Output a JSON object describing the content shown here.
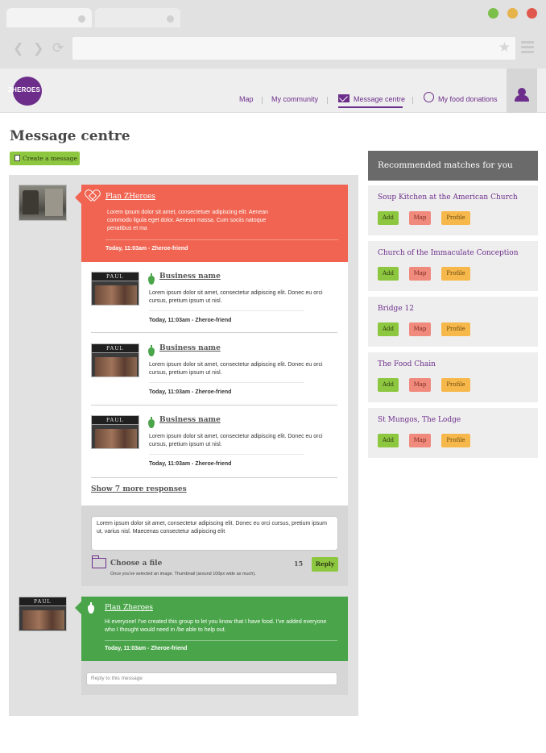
{
  "header": {
    "logo_text": "ZHEROES",
    "nav": {
      "map": "Map",
      "community": "My community",
      "messages": "Message centre",
      "donations": "My food donations"
    }
  },
  "page": {
    "title": "Message centre",
    "create_button": "Create a message"
  },
  "thread": {
    "main_post": {
      "author": "Plan ZHeroes",
      "text": "Lorem ipsum dolor sit amet, consectetuer adipiscing elit. Aenean commodo ligula eget dolor. Aenean massa. Cum sociis natoque penatibus et ma",
      "time": "Today, 11:03am - Zheroe-friend"
    },
    "responses": [
      {
        "shop_label": "PAUL",
        "author": "Business name",
        "text": "Lorem ipsum dolor sit amet, consectetur adipiscing elit. Donec eu orci cursus, pretium ipsum ut nisl.",
        "time": "Today, 11:03am - Zheroe-friend"
      },
      {
        "shop_label": "PAUL",
        "author": "Business name",
        "text": "Lorem ipsum dolor sit amet, consectetur adipiscing elit. Donec eu orci cursus, pretium ipsum ut nisl.",
        "time": "Today, 11:03am - Zheroe-friend"
      },
      {
        "shop_label": "PAUL",
        "author": "Business name",
        "text": "Lorem ipsum dolor sit amet, consectetur adipiscing elit. Donec eu orci cursus, pretium ipsum ut nisl.",
        "time": "Today, 11:03am - Zheroe-friend"
      }
    ],
    "show_more": "Show 7 more responses",
    "reply": {
      "draft": "Lorem ipsum dolor sit amet, consectetur adipiscing elit. Donec eu orci cursus, pretium ipsum ut, varius nisl. Maecenas consectetur adipiscing elit",
      "choose_file": "Choose a file",
      "file_hint": "Once you've selected an image. Thumbnail (around 100px wide as much).",
      "char_count": "15",
      "reply_button": "Reply"
    }
  },
  "second_thread": {
    "shop_label": "PAUL",
    "author": "Plan Zheroes",
    "text": "Hi everyone! I've created this group to let you know that I have food. I've added everyone who I thought would need in /be able to help out.",
    "time": "Today, 11:03am - Zheroe-friend",
    "reply_placeholder": "Reply to this message"
  },
  "recommended": {
    "title": "Recommended matches for you",
    "buttons": {
      "add": "Add",
      "map": "Map",
      "profile": "Profile"
    },
    "items": [
      {
        "name": "Soup Kitchen at the American Church"
      },
      {
        "name": "Church of the Immaculate Conception"
      },
      {
        "name": "Bridge 12"
      },
      {
        "name": "The Food Chain"
      },
      {
        "name": "St Mungos, The Lodge"
      }
    ]
  },
  "colors": {
    "brand_purple": "#6d2e8b",
    "accent_green": "#8dc63f",
    "post_red": "#f06451",
    "post_green": "#4aa54a"
  }
}
